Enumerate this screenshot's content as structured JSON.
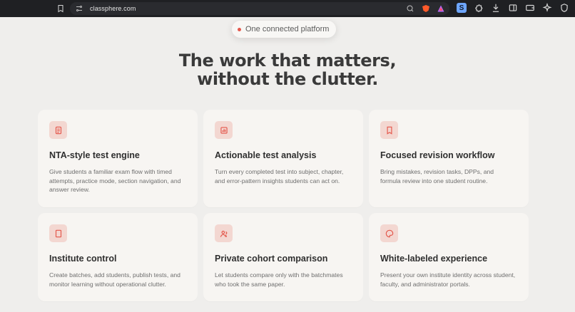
{
  "browser": {
    "url": "classphere.com"
  },
  "hero": {
    "pill": "One connected platform",
    "title": "The work that matters, without the clutter."
  },
  "features": [
    {
      "icon": "document-icon",
      "title": "NTA-style test engine",
      "description": "Give students a familiar exam flow with timed attempts, practice mode, section navigation, and answer review."
    },
    {
      "icon": "chart-icon",
      "title": "Actionable test analysis",
      "description": "Turn every completed test into subject, chapter, and error-pattern insights students can act on."
    },
    {
      "icon": "bookmark-icon",
      "title": "Focused revision workflow",
      "description": "Bring mistakes, revision tasks, DPPs, and formula review into one student routine."
    },
    {
      "icon": "building-icon",
      "title": "Institute control",
      "description": "Create batches, add students, publish tests, and monitor learning without operational clutter."
    },
    {
      "icon": "users-icon",
      "title": "Private cohort comparison",
      "description": "Let students compare only with the batchmates who took the same paper."
    },
    {
      "icon": "palette-icon",
      "title": "White-labeled experience",
      "description": "Present your own institute identity across student, faculty, and administrator portals."
    }
  ],
  "colors": {
    "accent": "#e4574b",
    "icon_background": "#f3d7d1",
    "page_background": "#efeeec",
    "card_background": "#f7f5f2"
  }
}
